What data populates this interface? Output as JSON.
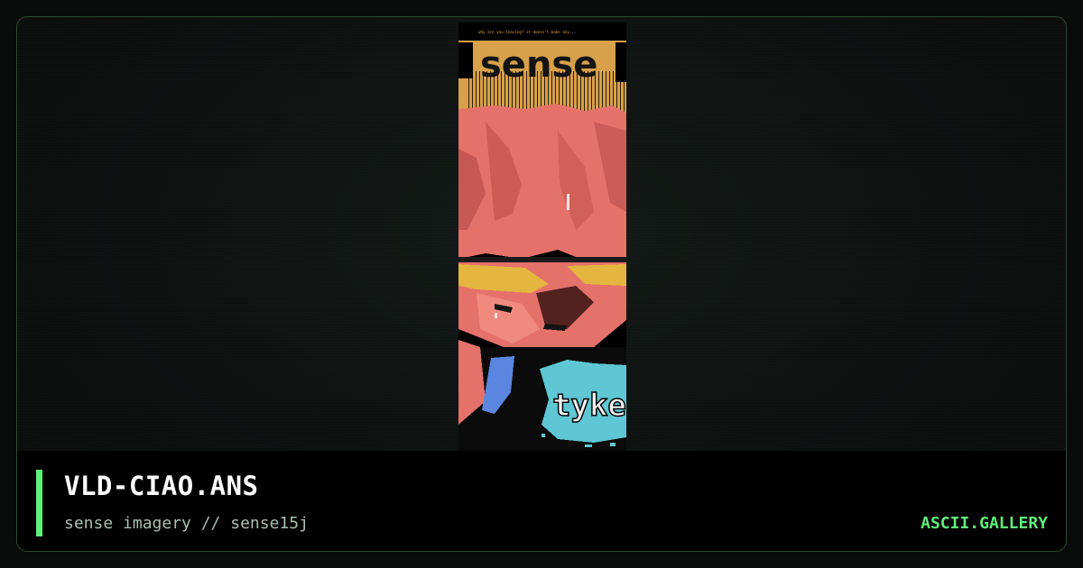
{
  "artwork": {
    "header_text": "why are you leaving?  it doesn't make any...",
    "logo_text": "sense",
    "tag_text": "tyke",
    "colors": {
      "sand": "#d7a04a",
      "pink": "#e5716b",
      "skin_shadow": "#c4544b",
      "yellow": "#e4b640",
      "blue": "#5a86e0",
      "cyan": "#5ec7d3"
    }
  },
  "footer": {
    "title": "VLD-CIAO.ANS",
    "subtitle": "sense imagery // sense15j",
    "brand": "ASCII.GALLERY"
  },
  "colors": {
    "accent": "#5ef07a",
    "border": "#2b4a2f"
  }
}
